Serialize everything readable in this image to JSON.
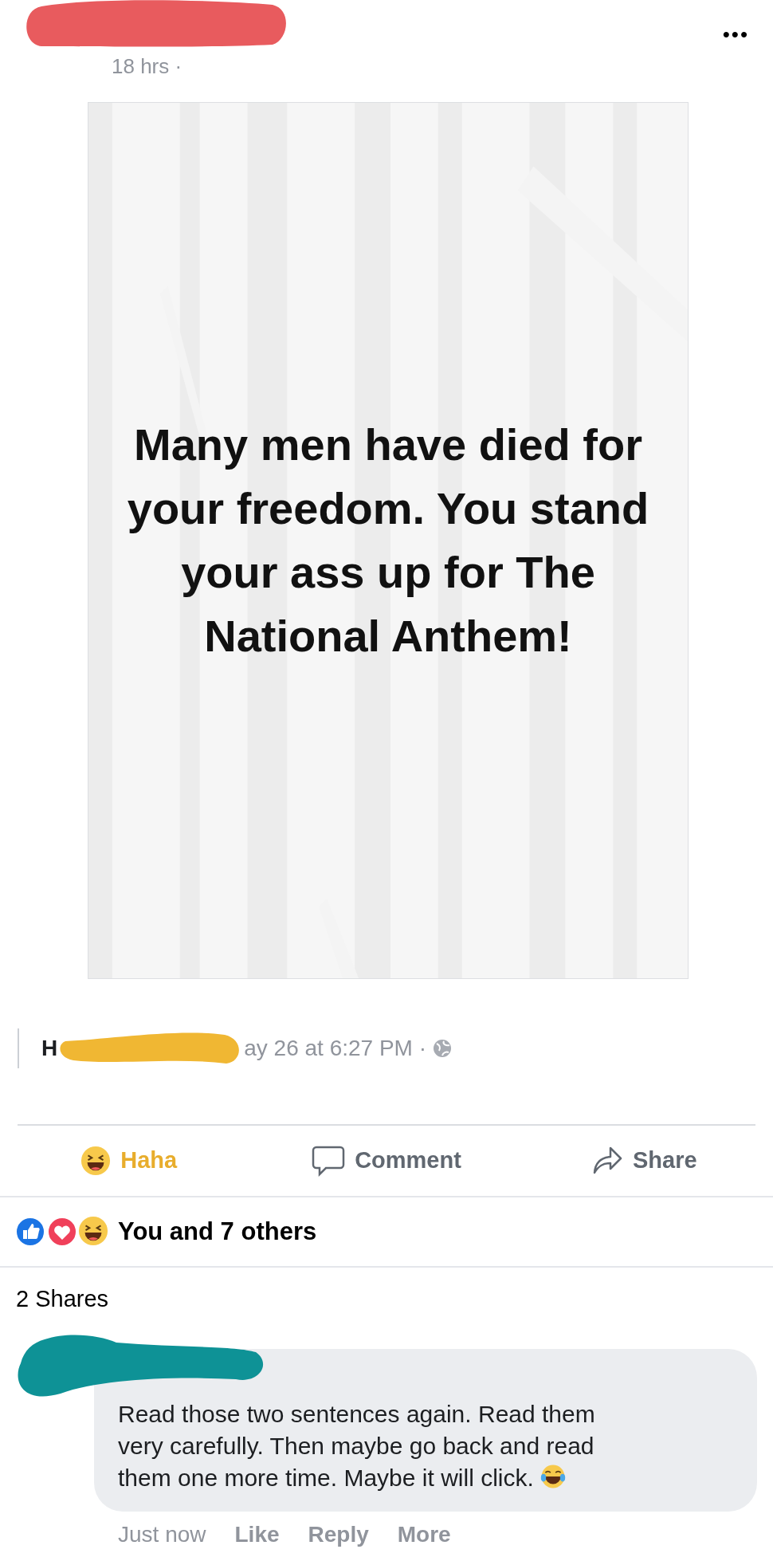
{
  "post": {
    "time": "18 hrs ·",
    "more": "•••"
  },
  "image": {
    "caption": "Many men have died for your freedom. You stand your ass up for The National Anthem!"
  },
  "shared": {
    "author_initial": "H",
    "time": "ay 26 at 6:27 PM ·"
  },
  "actions": [
    {
      "kind": "haha",
      "label": "Haha",
      "selected": true
    },
    {
      "kind": "comment",
      "label": "Comment",
      "selected": false
    },
    {
      "kind": "share",
      "label": "Share",
      "selected": false
    }
  ],
  "reactions": {
    "summary": "You and 7 others"
  },
  "shares": "2 Shares",
  "comment": {
    "text": "Read those two sentences again. Read them very carefully. Then maybe go back and read them one more time. Maybe it will click.",
    "time": "Just now",
    "links": [
      "Like",
      "Reply",
      "More"
    ]
  }
}
